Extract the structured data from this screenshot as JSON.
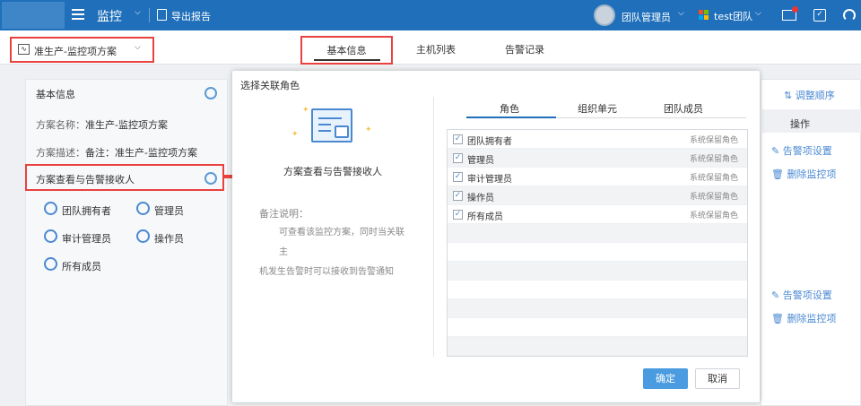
{
  "topbar": {
    "app_title": "监控",
    "title_caret": "⌵",
    "export_label": "导出报告",
    "user_name": "团队管理员",
    "user_caret": "⌵",
    "team_name": "test团队",
    "team_caret": "⌵",
    "check_glyph": "✓"
  },
  "scheme_select": {
    "label": "准生产-监控项方案",
    "caret": "⌵",
    "icon_glyph": "∿"
  },
  "tabs": [
    {
      "label": "基本信息"
    },
    {
      "label": "主机列表"
    },
    {
      "label": "告警记录"
    }
  ],
  "left_panel": {
    "title": "基本信息",
    "name_key": "方案名称：",
    "name_val": "准生产-监控项方案",
    "desc_key": "方案描述：",
    "desc_val": "备注：准生产-监控项方案",
    "receivers_label": "方案查看与告警接收人",
    "roles": [
      "团队拥有者",
      "管理员",
      "审计管理员",
      "操作员",
      "所有成员"
    ]
  },
  "right_panel": {
    "order_label": "⇅ 调整顺序",
    "header": "操作",
    "alert_setting": "告警项设置",
    "delete_item": "删除监控项"
  },
  "modal": {
    "title": "选择关联角色",
    "scheme_name": "方案查看与告警接收人",
    "notes_label": "备注说明：",
    "notes_line1": "可查看该监控方案，同时当关联主",
    "notes_line2": "机发生告警时可以接收到告警通知",
    "tabs": [
      "角色",
      "组织单元",
      "团队成员"
    ],
    "rows": [
      {
        "name": "团队拥有者",
        "type": "系统保留角色",
        "checked": "✓"
      },
      {
        "name": "管理员",
        "type": "系统保留角色",
        "checked": "✓"
      },
      {
        "name": "审计管理员",
        "type": "系统保留角色",
        "checked": "✓"
      },
      {
        "name": "操作员",
        "type": "系统保留角色",
        "checked": "✓"
      },
      {
        "name": "所有成员",
        "type": "系统保留角色",
        "checked": "✓"
      }
    ],
    "ok_label": "确定",
    "cancel_label": "取消"
  },
  "colors": {
    "primary": "#1f6fba",
    "annotation_red": "#e8423f",
    "accent_blue": "#4a9be0"
  }
}
